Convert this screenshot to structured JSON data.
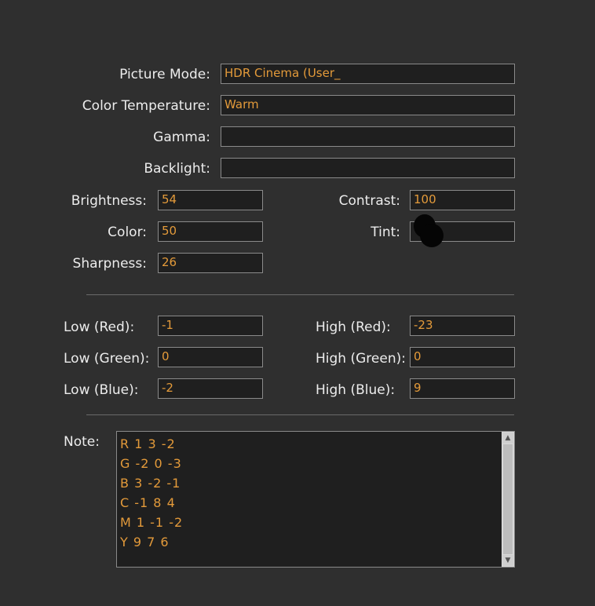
{
  "labels": {
    "picture_mode": "Picture Mode:",
    "color_temperature": "Color Temperature:",
    "gamma": "Gamma:",
    "backlight": "Backlight:",
    "brightness": "Brightness:",
    "contrast": "Contrast:",
    "color": "Color:",
    "tint": "Tint:",
    "sharpness": "Sharpness:",
    "low_red": "Low (Red):",
    "low_green": "Low (Green):",
    "low_blue": "Low (Blue):",
    "high_red": "High (Red):",
    "high_green": "High (Green):",
    "high_blue": "High (Blue):",
    "note": "Note:"
  },
  "values": {
    "picture_mode": "HDR Cinema (User_",
    "color_temperature": "Warm",
    "gamma": "",
    "backlight": "",
    "brightness": "54",
    "contrast": "100",
    "color": "50",
    "tint": "",
    "sharpness": "26",
    "low_red": "-1",
    "low_green": "0",
    "low_blue": "-2",
    "high_red": "-23",
    "high_green": "0",
    "high_blue": "9"
  },
  "note_lines": [
    "R 1 3 -2",
    "G -2 0 -3",
    "B 3 -2 -1",
    "C -1 8 4",
    "M 1 -1 -2",
    "Y 9 7 6"
  ],
  "icons": {
    "scroll_up": "triangle-up-icon",
    "scroll_down": "triangle-down-icon",
    "cursor": "mouse-cursor-icon"
  },
  "colors": {
    "background": "#2f2f2f",
    "field_bg": "#1f1f1f",
    "value_text": "#e39a3a",
    "label_text": "#ececec"
  }
}
